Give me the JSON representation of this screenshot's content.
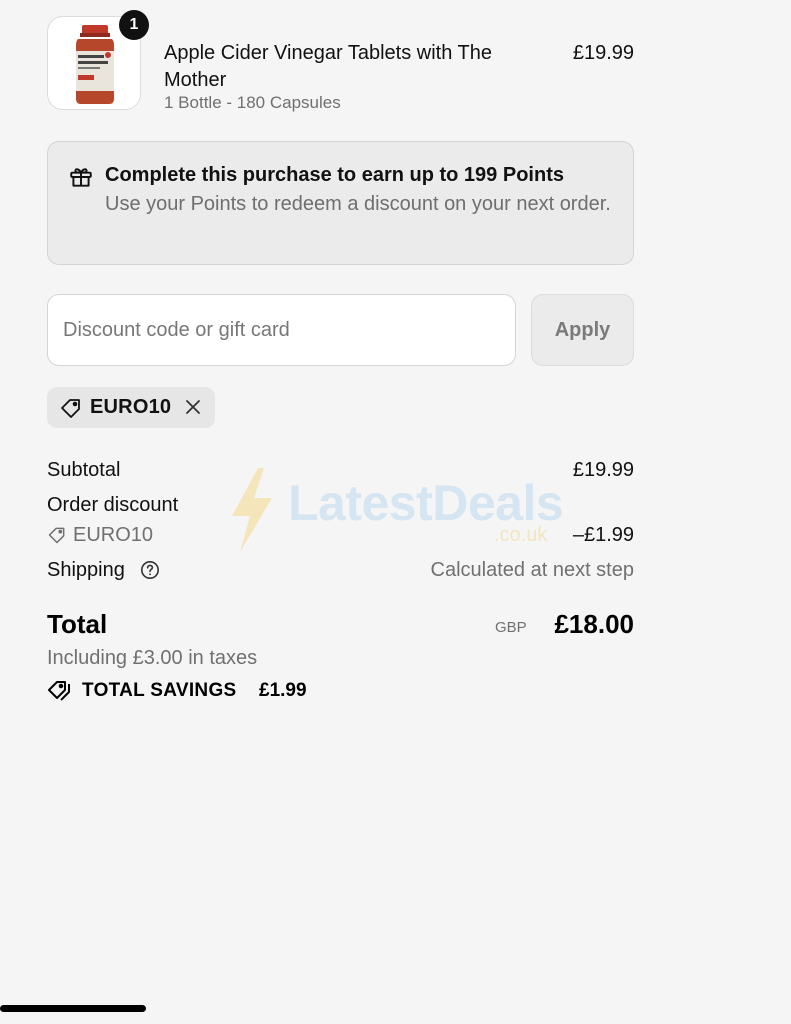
{
  "product": {
    "quantity": "1",
    "name": "Apple Cider Vinegar Tablets with The Mother",
    "variant": "1 Bottle - 180 Capsules",
    "price": "£19.99",
    "image_icon": "product-bottle-image"
  },
  "points": {
    "icon": "gift-icon",
    "title": "Complete this purchase to earn up to 199 Points",
    "subtitle": "Use your Points to redeem a discount on your next order."
  },
  "discount_form": {
    "placeholder": "Discount code or gift card",
    "value": "",
    "apply_label": "Apply"
  },
  "applied_code": {
    "icon": "tag-icon",
    "label": "EURO10",
    "remove_icon": "close-icon"
  },
  "summary": {
    "subtotal_label": "Subtotal",
    "subtotal_value": "£19.99",
    "discount_label": "Order discount",
    "discount_code": "EURO10",
    "discount_value": "–£1.99",
    "shipping_label": "Shipping",
    "shipping_help_icon": "help-circle-icon",
    "shipping_value": "Calculated at next step",
    "total_label": "Total",
    "total_currency": "GBP",
    "total_value": "£18.00",
    "tax_note": "Including £3.00 in taxes",
    "savings_icon": "tags-icon",
    "savings_label": "TOTAL SAVINGS",
    "savings_value": "£1.99"
  },
  "watermark": {
    "text": "LatestDeals",
    "sub": ".co.uk"
  },
  "colors": {
    "background": "#f5f5f5",
    "panel": "#ebebeb",
    "text": "#111111",
    "muted": "#707070",
    "badge": "#111111"
  }
}
